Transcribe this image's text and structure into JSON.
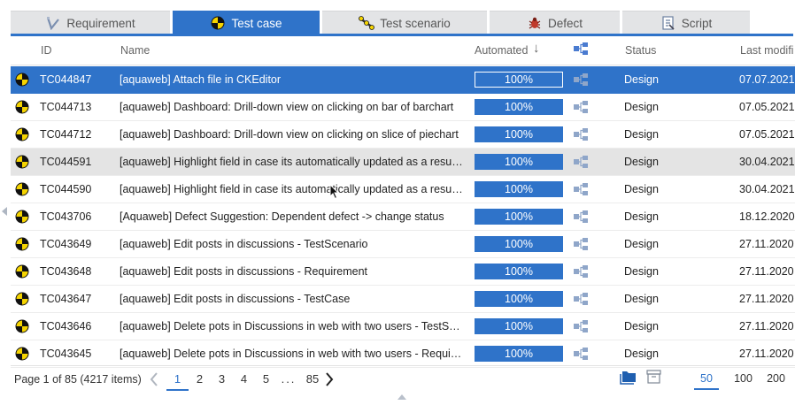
{
  "tabs": [
    {
      "label": "Requirement",
      "icon": "requirement-icon",
      "active": false
    },
    {
      "label": "Test case",
      "icon": "test-case-icon",
      "active": true
    },
    {
      "label": "Test scenario",
      "icon": "test-scenario-icon",
      "active": false
    },
    {
      "label": "Defect",
      "icon": "bug-icon",
      "active": false
    },
    {
      "label": "Script",
      "icon": "script-icon",
      "active": false
    }
  ],
  "columns": {
    "id": "ID",
    "name": "Name",
    "automated": "Automated",
    "sort_indicator": "↓",
    "status": "Status",
    "last_modified": "Last modifi"
  },
  "rows": [
    {
      "id": "TC044847",
      "name": "[aquaweb] Attach file in CKEditor",
      "automated": "100%",
      "status": "Design",
      "date": "07.07.2021",
      "state": "selected"
    },
    {
      "id": "TC044713",
      "name": "[aquaweb] Dashboard: Drill-down view on clicking on bar of barchart",
      "automated": "100%",
      "status": "Design",
      "date": "07.05.2021",
      "state": ""
    },
    {
      "id": "TC044712",
      "name": "[aquaweb] Dashboard: Drill-down view on clicking on slice of piechart",
      "automated": "100%",
      "status": "Design",
      "date": "07.05.2021",
      "state": ""
    },
    {
      "id": "TC044591",
      "name": "[aquaweb] Highlight field in case its automatically updated as a result …",
      "automated": "100%",
      "status": "Design",
      "date": "30.04.2021",
      "state": "hover"
    },
    {
      "id": "TC044590",
      "name": "[aquaweb] Highlight field in case its automatically updated as a result …",
      "automated": "100%",
      "status": "Design",
      "date": "30.04.2021",
      "state": ""
    },
    {
      "id": "TC043706",
      "name": "[Aquaweb] Defect Suggestion: Dependent defect -> change status",
      "automated": "100%",
      "status": "Design",
      "date": "18.12.2020",
      "state": ""
    },
    {
      "id": "TC043649",
      "name": "[aquaweb] Edit posts in discussions - TestScenario",
      "automated": "100%",
      "status": "Design",
      "date": "27.11.2020",
      "state": ""
    },
    {
      "id": "TC043648",
      "name": "[aquaweb] Edit posts in discussions - Requirement",
      "automated": "100%",
      "status": "Design",
      "date": "27.11.2020",
      "state": ""
    },
    {
      "id": "TC043647",
      "name": "[aquaweb] Edit posts in discussions - TestCase",
      "automated": "100%",
      "status": "Design",
      "date": "27.11.2020",
      "state": ""
    },
    {
      "id": "TC043646",
      "name": "[aquaweb] Delete pots in Discussions in web with two users - TestSce…",
      "automated": "100%",
      "status": "Design",
      "date": "27.11.2020",
      "state": ""
    },
    {
      "id": "TC043645",
      "name": "[aquaweb] Delete pots in Discussions in web with two users - Require…",
      "automated": "100%",
      "status": "Design",
      "date": "27.11.2020",
      "state": ""
    }
  ],
  "pager": {
    "info": "Page 1 of 85 (4217 items)",
    "pages": [
      "1",
      "2",
      "3",
      "4",
      "5",
      "...",
      "85"
    ],
    "current_page": "1",
    "page_sizes": [
      "50",
      "100",
      "200"
    ],
    "current_size": "50"
  },
  "colors": {
    "accent": "#2f73c9",
    "tab_inactive": "#e3e4e6",
    "row_hover": "#e4e4e4"
  }
}
